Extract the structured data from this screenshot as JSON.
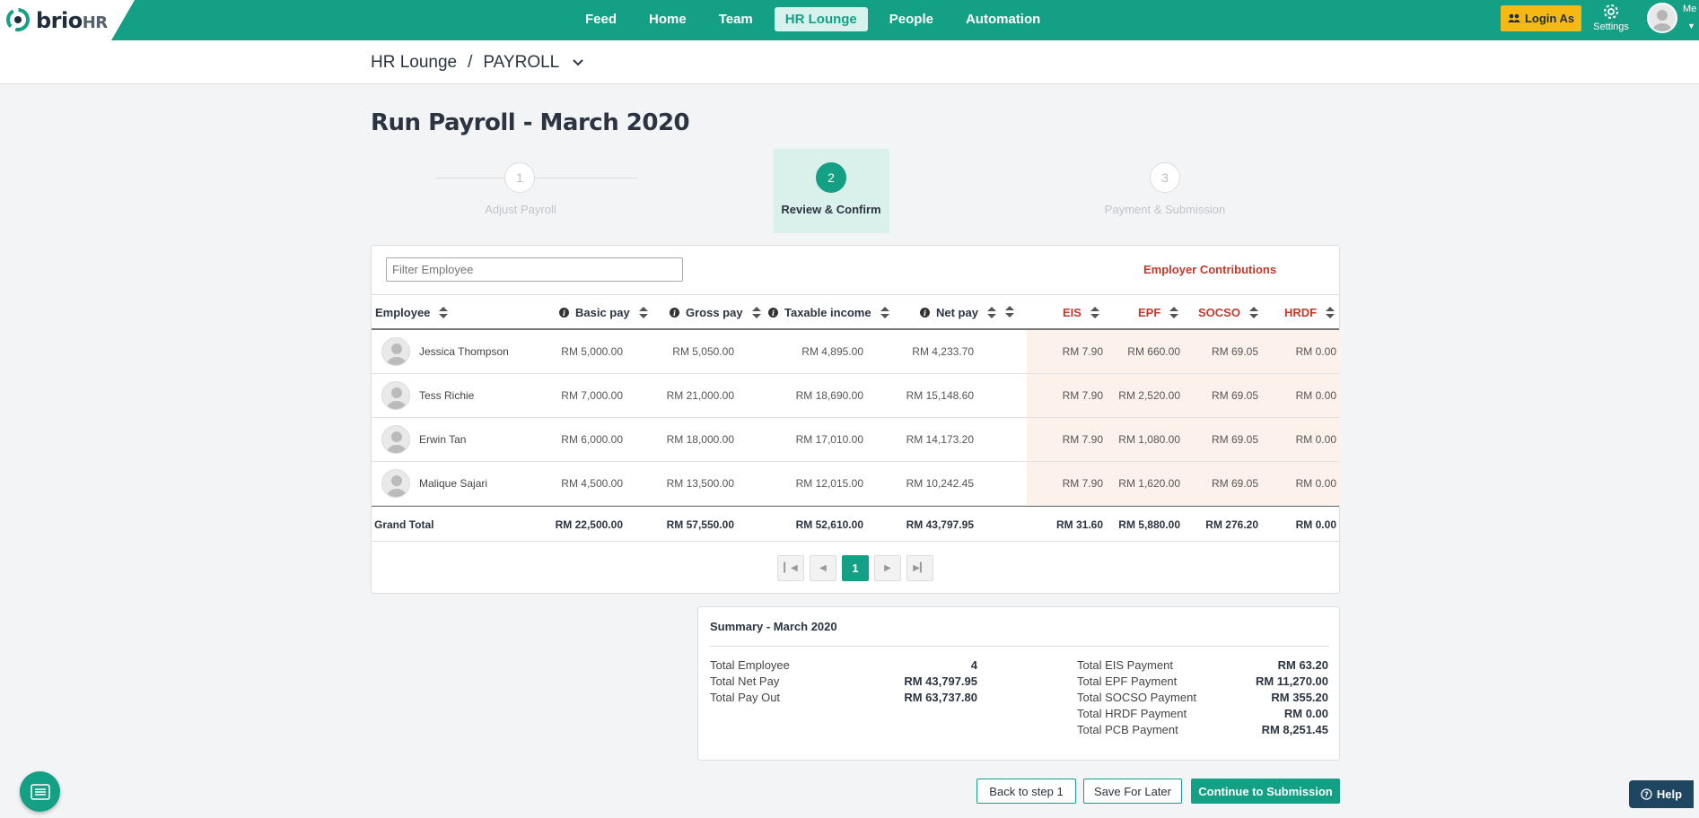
{
  "app": {
    "logo_text": "brio",
    "logo_suffix": "HR"
  },
  "nav": {
    "items": [
      {
        "label": "Feed"
      },
      {
        "label": "Home"
      },
      {
        "label": "Team"
      },
      {
        "label": "HR Lounge",
        "active": true
      },
      {
        "label": "People"
      },
      {
        "label": "Automation"
      }
    ],
    "login_as": "Login As",
    "settings": "Settings",
    "user": "Me"
  },
  "breadcrumb": {
    "root": "HR Lounge",
    "separator": "/",
    "current": "PAYROLL"
  },
  "page_title": "Run Payroll - March 2020",
  "stepper": [
    {
      "number": "1",
      "label": "Adjust Payroll"
    },
    {
      "number": "2",
      "label": "Review & Confirm",
      "active": true
    },
    {
      "number": "3",
      "label": "Payment & Submission"
    }
  ],
  "table": {
    "filter_placeholder": "Filter Employee",
    "employer_contributions": "Employer Contributions",
    "columns": {
      "employee": "Employee",
      "basic_pay": "Basic pay",
      "gross_pay": "Gross pay",
      "taxable_income": "Taxable income",
      "net_pay": "Net pay",
      "eis": "EIS",
      "epf": "EPF",
      "socso": "SOCSO",
      "hrdf": "HRDF"
    },
    "rows": [
      {
        "name": "Jessica Thompson",
        "basic": "RM 5,000.00",
        "gross": "RM 5,050.00",
        "taxable": "RM 4,895.00",
        "net": "RM 4,233.70",
        "eis": "RM 7.90",
        "epf": "RM 660.00",
        "socso": "RM 69.05",
        "hrdf": "RM 0.00"
      },
      {
        "name": "Tess Richie",
        "basic": "RM 7,000.00",
        "gross": "RM 21,000.00",
        "taxable": "RM 18,690.00",
        "net": "RM 15,148.60",
        "eis": "RM 7.90",
        "epf": "RM 2,520.00",
        "socso": "RM 69.05",
        "hrdf": "RM 0.00"
      },
      {
        "name": "Erwin Tan",
        "basic": "RM 6,000.00",
        "gross": "RM 18,000.00",
        "taxable": "RM 17,010.00",
        "net": "RM 14,173.20",
        "eis": "RM 7.90",
        "epf": "RM 1,080.00",
        "socso": "RM 69.05",
        "hrdf": "RM 0.00"
      },
      {
        "name": "Malique Sajari",
        "basic": "RM 4,500.00",
        "gross": "RM 13,500.00",
        "taxable": "RM 12,015.00",
        "net": "RM 10,242.45",
        "eis": "RM 7.90",
        "epf": "RM 1,620.00",
        "socso": "RM 69.05",
        "hrdf": "RM 0.00"
      }
    ],
    "grand_total": {
      "label": "Grand Total",
      "basic": "RM 22,500.00",
      "gross": "RM 57,550.00",
      "taxable": "RM 52,610.00",
      "net": "RM 43,797.95",
      "eis": "RM 31.60",
      "epf": "RM 5,880.00",
      "socso": "RM 276.20",
      "hrdf": "RM 0.00"
    },
    "pagination": {
      "current_page": "1"
    }
  },
  "summary": {
    "title": "Summary - March 2020",
    "left": [
      {
        "label": "Total Employee",
        "value": "4"
      },
      {
        "label": "Total Net Pay",
        "value": "RM 43,797.95"
      },
      {
        "label": "Total Pay Out",
        "value": "RM 63,737.80"
      }
    ],
    "right": [
      {
        "label": "Total EIS Payment",
        "value": "RM 63.20"
      },
      {
        "label": "Total EPF Payment",
        "value": "RM 11,270.00"
      },
      {
        "label": "Total SOCSO Payment",
        "value": "RM 355.20"
      },
      {
        "label": "Total HRDF Payment",
        "value": "RM 0.00"
      },
      {
        "label": "Total PCB Payment",
        "value": "RM 8,251.45"
      }
    ]
  },
  "actions": {
    "back": "Back to step 1",
    "save": "Save For Later",
    "continue": "Continue to Submission"
  },
  "help": "Help",
  "colors": {
    "brand": "#14a085",
    "accent": "#f6b812",
    "contribution_red": "#c0392b",
    "help_bg": "#1f4660"
  }
}
